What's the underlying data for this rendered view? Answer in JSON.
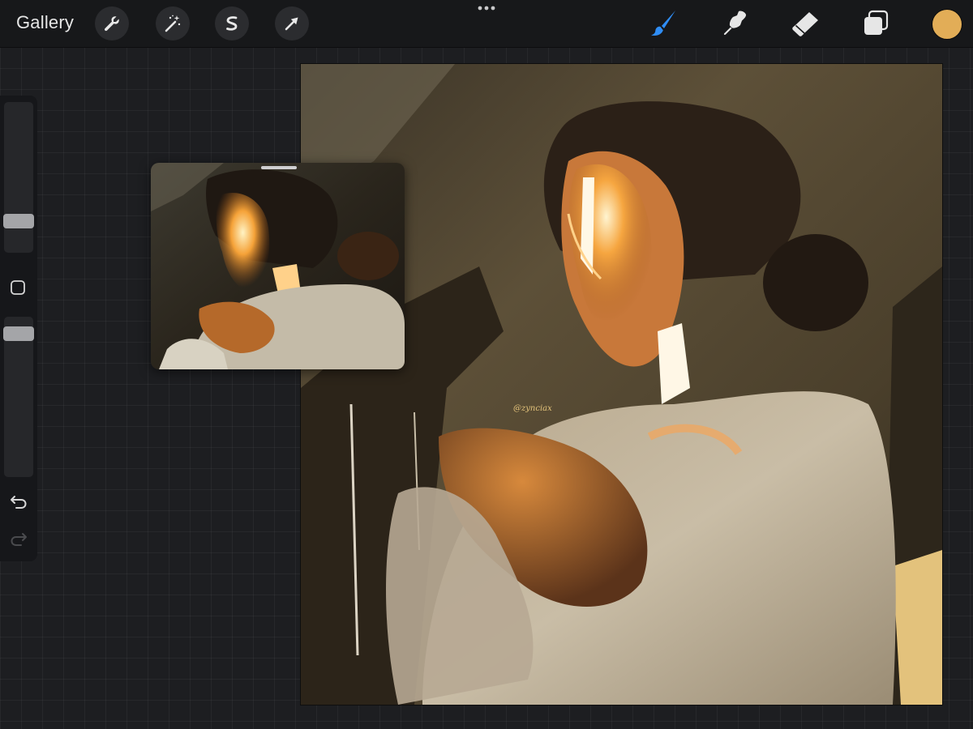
{
  "toolbar": {
    "gallery_label": "Gallery",
    "left_actions": [
      {
        "name": "wrench-icon",
        "title": "Actions"
      },
      {
        "name": "magic-wand-icon",
        "title": "Adjustments"
      },
      {
        "name": "selection-icon",
        "title": "Selection"
      },
      {
        "name": "arrow-icon",
        "title": "Transform"
      }
    ],
    "right_tools": [
      {
        "name": "brush-icon",
        "title": "Paint",
        "active": true
      },
      {
        "name": "smudge-icon",
        "title": "Smudge",
        "active": false
      },
      {
        "name": "eraser-icon",
        "title": "Erase",
        "active": false
      },
      {
        "name": "layers-icon",
        "title": "Layers",
        "active": false
      }
    ],
    "active_color": "#e2ad57",
    "accent_color": "#2f8df5"
  },
  "sidebar": {
    "brush_size_level": 0.79,
    "opacity_level": 0.88,
    "buttons": [
      "undo-icon",
      "redo-icon",
      "square-modify-icon"
    ]
  },
  "canvas": {
    "signature_text": "@zynciax"
  },
  "reference_window": {
    "content": "reference-photo"
  }
}
